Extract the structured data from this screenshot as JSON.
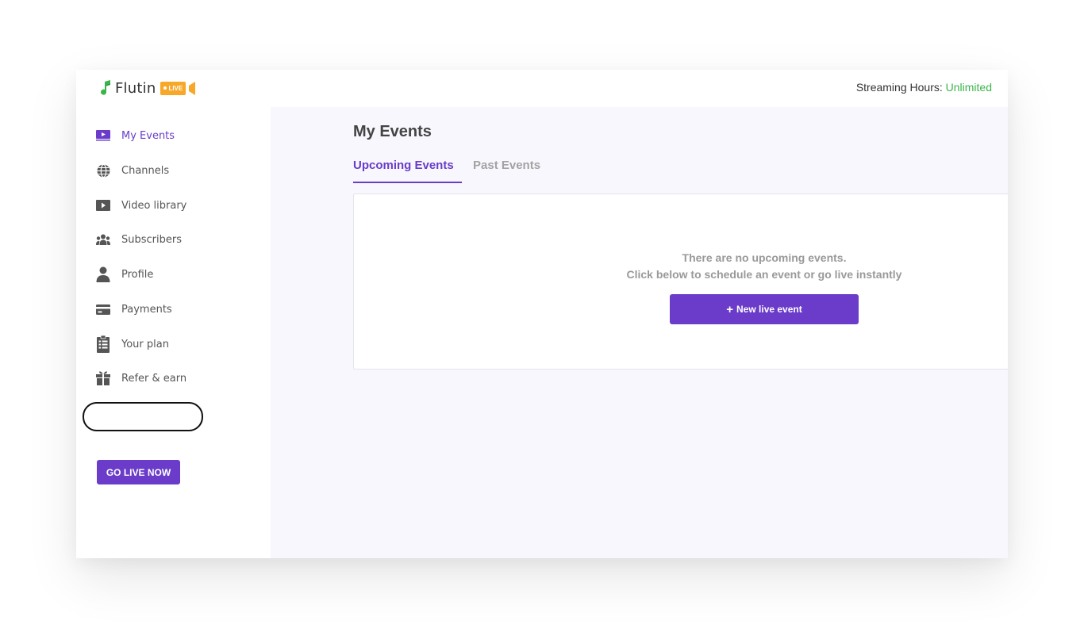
{
  "brand": {
    "name": "Flutin",
    "badge": "LIVE",
    "colors": {
      "accent": "#6a3cc9",
      "badge": "#f7a829",
      "note": "#3ab549"
    }
  },
  "header": {
    "streaming_label": "Streaming Hours:",
    "streaming_value": "Unlimited"
  },
  "sidebar": {
    "items": [
      {
        "label": "My Events",
        "icon": "video-screen-icon",
        "active": true
      },
      {
        "label": "Channels",
        "icon": "globe-icon"
      },
      {
        "label": "Video library",
        "icon": "play-folder-icon"
      },
      {
        "label": "Subscribers",
        "icon": "users-icon"
      },
      {
        "label": "Profile",
        "icon": "person-icon"
      },
      {
        "label": "Payments",
        "icon": "card-icon"
      },
      {
        "label": "Your plan",
        "icon": "clipboard-icon"
      },
      {
        "label": "Refer & earn",
        "icon": "gift-icon"
      }
    ],
    "go_live_label": "GO LIVE NOW"
  },
  "main": {
    "title": "My Events",
    "tabs": [
      {
        "label": "Upcoming Events",
        "active": true
      },
      {
        "label": "Past Events",
        "active": false
      }
    ],
    "empty_state": {
      "line1": "There are no upcoming events.",
      "line2": "Click below to schedule an event or go live instantly",
      "button_label": "New live event"
    }
  }
}
